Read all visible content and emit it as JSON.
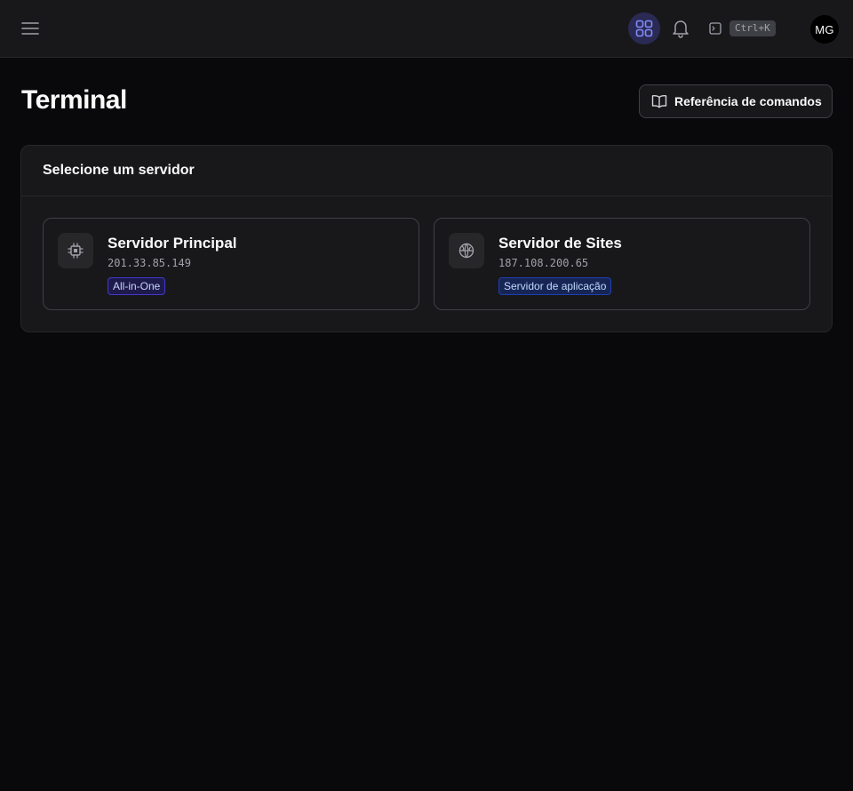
{
  "header": {
    "menu_icon": "hamburger-menu-icon",
    "apps_icon": "grid-icon",
    "notifications_icon": "bell-icon",
    "command_icon": "terminal-icon",
    "command_shortcut": "Ctrl+K",
    "avatar_initials": "MG"
  },
  "page": {
    "title": "Terminal",
    "reference_button": "Referência de comandos",
    "reference_icon": "book-open-icon"
  },
  "server_panel": {
    "title": "Selecione um servidor",
    "servers": [
      {
        "name": "Servidor Principal",
        "ip": "201.33.85.149",
        "badge": "All-in-One",
        "icon": "cpu-chip-icon",
        "badge_color": "#c7d2fe"
      },
      {
        "name": "Servidor de Sites",
        "ip": "187.108.200.65",
        "badge": "Servidor de aplicação",
        "icon": "globe-icon",
        "badge_color": "#bfdbfe"
      }
    ]
  },
  "colors": {
    "background": "#09090b",
    "surface": "#18181b",
    "border": "#27272a",
    "accent": "#818cf8"
  }
}
